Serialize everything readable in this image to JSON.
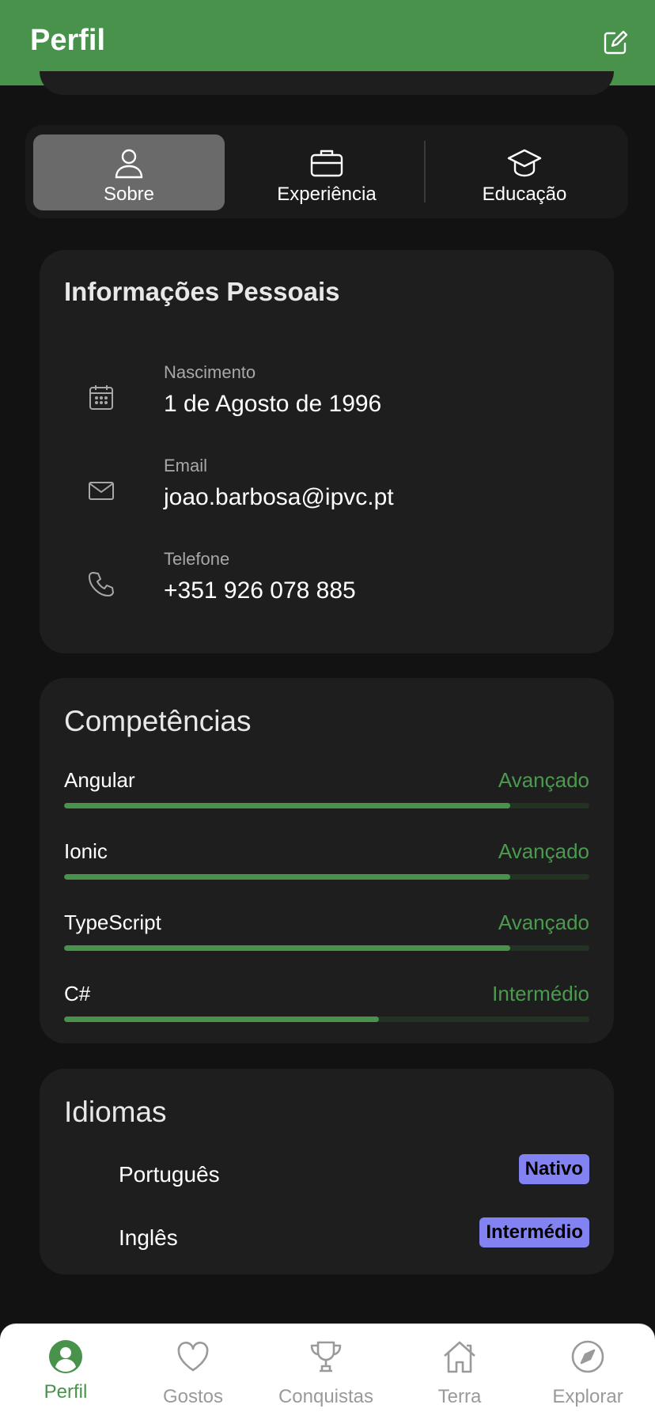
{
  "header": {
    "title": "Perfil",
    "edit_icon": "edit-icon"
  },
  "segments": [
    {
      "label": "Sobre",
      "icon": "person-icon",
      "active": true
    },
    {
      "label": "Experiência",
      "icon": "briefcase-icon",
      "active": false
    },
    {
      "label": "Educação",
      "icon": "graduation-cap-icon",
      "active": false
    }
  ],
  "personal": {
    "title": "Informações Pessoais",
    "rows": [
      {
        "label": "Nascimento",
        "value": "1 de Agosto de 1996",
        "icon": "calendar-icon"
      },
      {
        "label": "Email",
        "value": "joao.barbosa@ipvc.pt",
        "icon": "mail-icon"
      },
      {
        "label": "Telefone",
        "value": "+351 926 078 885",
        "icon": "phone-icon"
      }
    ]
  },
  "skills": {
    "title": "Competências",
    "items": [
      {
        "name": "Angular",
        "level": "Avançado",
        "progress": 0.85
      },
      {
        "name": "Ionic",
        "level": "Avançado",
        "progress": 0.85
      },
      {
        "name": "TypeScript",
        "level": "Avançado",
        "progress": 0.85
      },
      {
        "name": "C#",
        "level": "Intermédio",
        "progress": 0.6
      }
    ]
  },
  "languages": {
    "title": "Idiomas",
    "items": [
      {
        "name": "Português",
        "level": "Nativo"
      },
      {
        "name": "Inglês",
        "level": "Intermédio"
      }
    ]
  },
  "tabs": [
    {
      "label": "Perfil",
      "icon": "profile-icon",
      "active": true
    },
    {
      "label": "Gostos",
      "icon": "heart-icon",
      "active": false
    },
    {
      "label": "Conquistas",
      "icon": "trophy-icon",
      "active": false
    },
    {
      "label": "Terra",
      "icon": "home-icon",
      "active": false
    },
    {
      "label": "Explorar",
      "icon": "compass-icon",
      "active": false
    }
  ],
  "colors": {
    "brand": "#48924c",
    "badge": "#8282f2",
    "background": "#121212",
    "card": "#1e1e1e"
  }
}
